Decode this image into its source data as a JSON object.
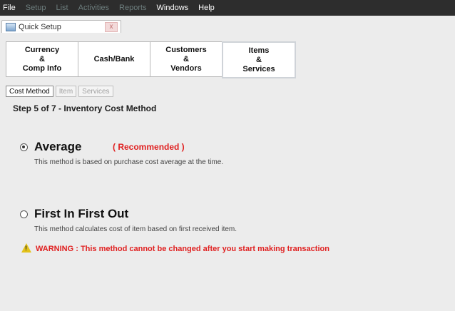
{
  "menu": {
    "items": [
      {
        "label": "File",
        "enabled": true
      },
      {
        "label": "Setup",
        "enabled": false
      },
      {
        "label": "List",
        "enabled": false
      },
      {
        "label": "Activities",
        "enabled": false
      },
      {
        "label": "Reports",
        "enabled": false
      },
      {
        "label": "Windows",
        "enabled": true
      },
      {
        "label": "Help",
        "enabled": true
      }
    ]
  },
  "window_tab": {
    "label": "Quick Setup",
    "close": "x"
  },
  "top_tabs": [
    {
      "label": "Currency\n&\nComp Info",
      "active": false
    },
    {
      "label": "Cash/Bank",
      "active": false
    },
    {
      "label": "Customers\n&\nVendors",
      "active": false
    },
    {
      "label": "Items\n&\nServices",
      "active": true
    }
  ],
  "sub_tabs": [
    {
      "label": "Cost Method",
      "active": true
    },
    {
      "label": "Item",
      "active": false
    },
    {
      "label": "Services",
      "active": false
    }
  ],
  "step_title": "Step 5 of 7   - Inventory Cost Method",
  "options": {
    "average": {
      "title": "Average",
      "recommended": "( Recommended )",
      "desc": "This method is based on purchase cost average at the time.",
      "selected": true
    },
    "fifo": {
      "title": "First In First Out",
      "desc": "This method calculates cost of item based on first received item.",
      "selected": false
    }
  },
  "warning": "WARNING :  This method cannot be changed after you start making transaction",
  "colors": {
    "accent_red": "#e02020",
    "menubar": "#2d2d2d",
    "panel": "#ececec"
  }
}
